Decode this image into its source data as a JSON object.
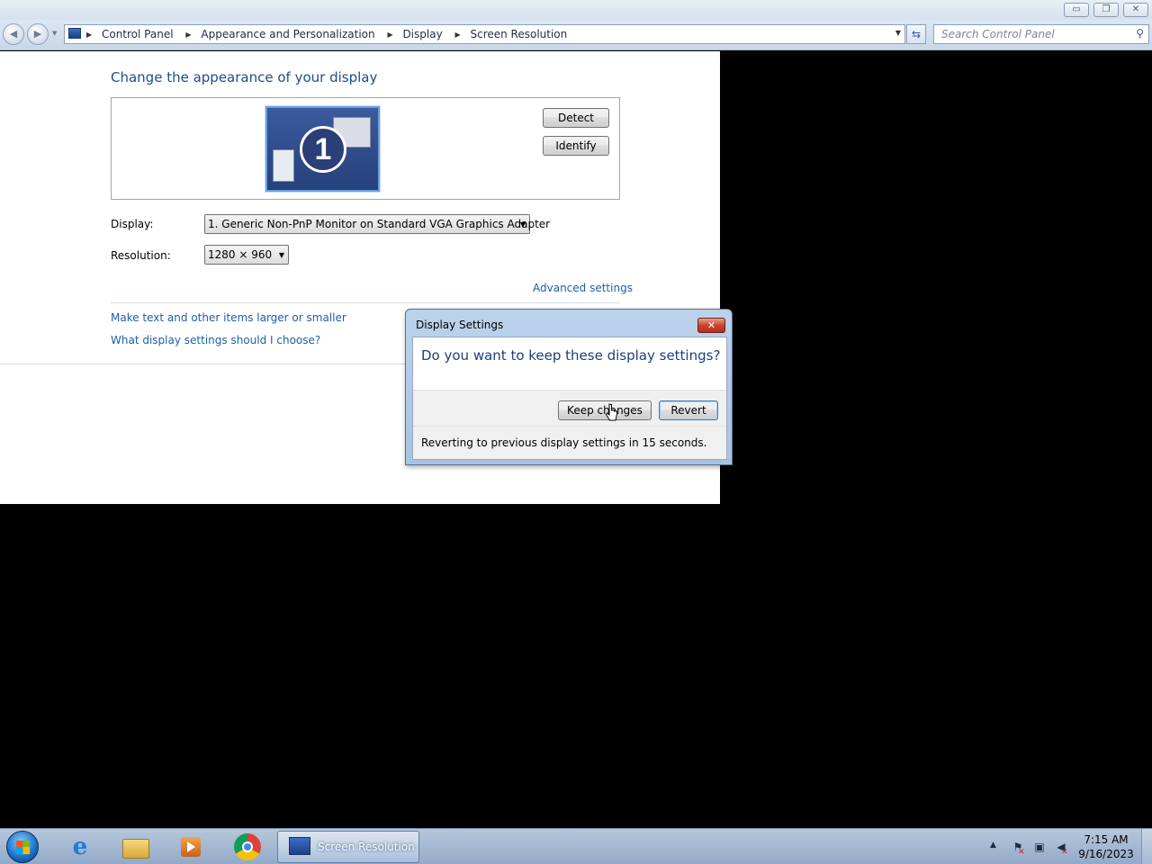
{
  "window": {
    "minimize_icon": "minimize-icon",
    "maximize_icon": "restore-icon",
    "close_icon": "close-icon"
  },
  "navbar": {
    "breadcrumbs": [
      "Control Panel",
      "Appearance and Personalization",
      "Display",
      "Screen Resolution"
    ],
    "search_placeholder": "Search Control Panel"
  },
  "main": {
    "title": "Change the appearance of your display",
    "monitor_number": "1",
    "detect_label": "Detect",
    "identify_label": "Identify",
    "display_label": "Display:",
    "display_value": "1. Generic Non-PnP Monitor on Standard VGA Graphics Adapter",
    "resolution_label": "Resolution:",
    "resolution_value": "1280 × 960",
    "advanced_link": "Advanced settings",
    "text_size_link": "Make text and other items larger or smaller",
    "help_link": "What display settings should I choose?"
  },
  "dialog": {
    "title": "Display Settings",
    "question": "Do you want to keep these display settings?",
    "keep_label": "Keep changes",
    "revert_label": "Revert",
    "countdown": "Reverting to previous display settings in 15 seconds."
  },
  "taskbar": {
    "active_task": "Screen Resolution",
    "ie_glyph": "e",
    "time": "7:15 AM",
    "date": "9/16/2023"
  },
  "colors": {
    "link": "#1e5eaa",
    "title": "#1e4d8c",
    "close_button": "#c9452e"
  }
}
